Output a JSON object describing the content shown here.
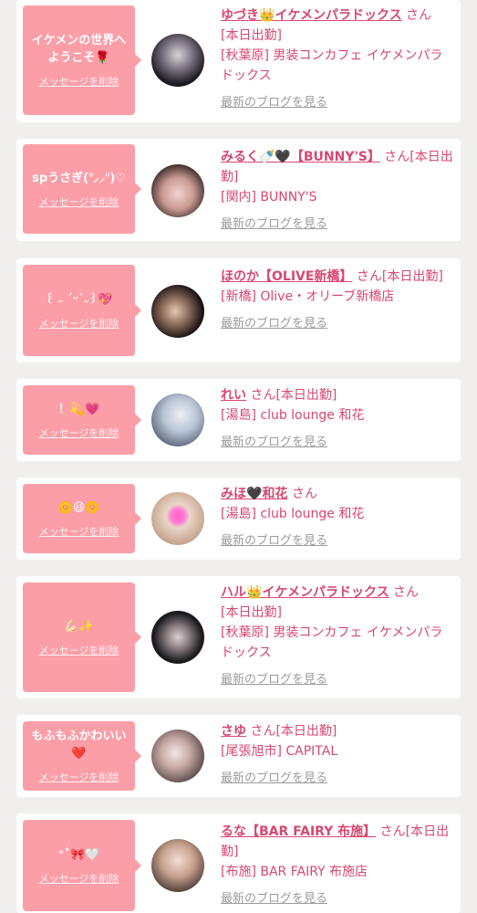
{
  "common": {
    "delete_label": "メッセージを削除",
    "blog_label": "最新のブログを見る",
    "san": "さん"
  },
  "cards": [
    {
      "message": "イケメンの世界へようこそ🌹",
      "name": "ゆづき👑イケメンパラドックス",
      "status": "[本日出勤]",
      "shop": "[秋葉原] 男装コンカフェ イケメンパラドックス"
    },
    {
      "message": "spうさぎ(ᐡ⸝⸝ᐡ)♡",
      "name": "みるく🍼🖤【BUNNY'S】",
      "status": "[本日出勤]",
      "shop": "[関内] BUNNY'S"
    },
    {
      "message": "꒰ ˶ ˊᵕˋ˶꒱💖",
      "name": "ほのか【OLIVE新橋】",
      "status": "[本日出勤]",
      "shop": "[新橋] Olive・オリーブ新橋店"
    },
    {
      "message": "！💫💗",
      "name": "れい",
      "status": "[本日出勤]",
      "shop": "[湯島] club lounge 和花"
    },
    {
      "message": "🌼😆🌼",
      "name": "みほ🖤和花",
      "status": "",
      "shop": "[湯島] club lounge 和花"
    },
    {
      "message": "💪🏻✨",
      "name": "ハル👑イケメンパラドックス",
      "status": "[本日出勤]",
      "shop": "[秋葉原] 男装コンカフェ イケメンパラドックス"
    },
    {
      "message": "もふもふかわいい❤️",
      "name": "さゆ",
      "status": "[本日出勤]",
      "shop": "[尾張旭市] CAPITAL"
    },
    {
      "message": "⁺˚🎀🤍",
      "name": "るな【BAR FAIRY 布施】",
      "status": "[本日出勤]",
      "shop": "[布施] BAR FAIRY 布施店"
    }
  ]
}
